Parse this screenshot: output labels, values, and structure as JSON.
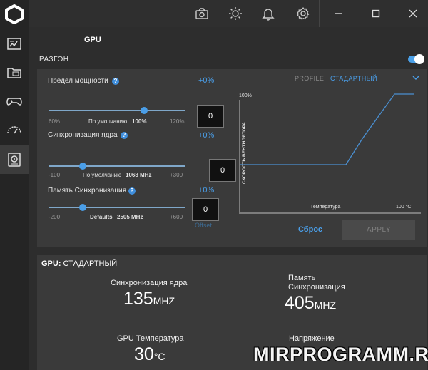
{
  "gpu_title": "GPU",
  "section_label": "РАЗГОН",
  "power": {
    "label": "Предел мощности",
    "pct": "+0%",
    "min": "60%",
    "max": "120%",
    "default_prefix": "По умолчанию",
    "default_value": "100%",
    "value": "0",
    "level": 0.7
  },
  "core": {
    "label": "Синхронизация ядра",
    "pct": "+0%",
    "min": "-100",
    "max": "+300",
    "default_prefix": "По умолчанию",
    "default_value": "1068 MHz",
    "value": "0",
    "level": 0.25
  },
  "memory": {
    "label": "Память Синхронизация",
    "pct": "+0%",
    "min": "-200",
    "max": "+600",
    "default_prefix": "Defaults",
    "default_value": "2505 MHz",
    "value": "0",
    "level": 0.25,
    "offset_label": "Offset"
  },
  "profile": {
    "label": "PROFILE:",
    "value": "СТАДАРТНЫЙ"
  },
  "fan_chart": {
    "ylabel": "СКОРОСТЬ ВЕНТИЛЯТОРА",
    "ymax_label": "100%",
    "xlabel": "Температура",
    "xmax_label": "100 °C"
  },
  "reset_label": "Сброс",
  "apply_label": "APPLY",
  "status": {
    "title_bold": "GPU:",
    "title_rest": " СТАДАРТНЫЙ",
    "core_label": "Синхронизация ядра",
    "core_value": "135",
    "core_unit": "MHZ",
    "mem_label_line1": "Память",
    "mem_label_line2": "Синхронизация",
    "mem_value": "405",
    "mem_unit": "MHZ",
    "temp_label": "GPU Температура",
    "temp_value": "30",
    "temp_unit": "°C",
    "volt_label": "Напряжение"
  },
  "watermark": "MIRPROGRAMM.RU",
  "colors": {
    "accent": "#4a9ee8",
    "background": "#2d2d2d",
    "panel": "#3a3a3a"
  }
}
